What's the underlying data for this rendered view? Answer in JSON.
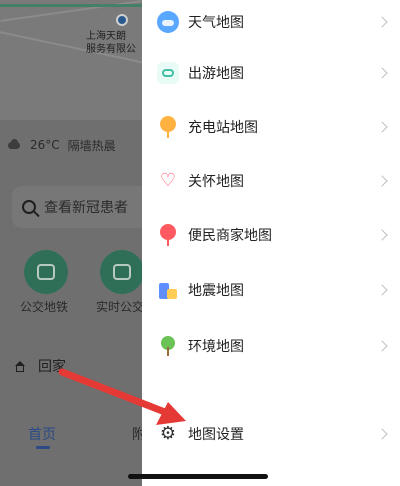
{
  "background": {
    "map_label": "上海天朗\n服务有限公",
    "weather": {
      "temperature": "26°C",
      "text": "隔墙热晨"
    },
    "search": {
      "placeholder": "查看新冠患者"
    },
    "quick_actions": [
      {
        "label": "公交地铁",
        "icon": "bus-icon"
      },
      {
        "label": "实时公交",
        "icon": "realtime-bus-icon"
      }
    ],
    "home_label": "回家",
    "tabs": [
      {
        "label": "首页"
      },
      {
        "label": "附"
      }
    ]
  },
  "menu": {
    "items": [
      {
        "label": "天气地图",
        "icon": "weather-icon"
      },
      {
        "label": "出游地图",
        "icon": "travel-icon"
      },
      {
        "label": "充电站地图",
        "icon": "charging-station-icon"
      },
      {
        "label": "关怀地图",
        "icon": "care-heart-icon"
      },
      {
        "label": "便民商家地图",
        "icon": "merchant-icon"
      },
      {
        "label": "地震地图",
        "icon": "earthquake-icon"
      },
      {
        "label": "环境地图",
        "icon": "environment-tree-icon"
      },
      {
        "label": "地图设置",
        "icon": "gear-icon"
      }
    ]
  },
  "annotation": {
    "arrow_color": "#e53935",
    "arrow_icon": "arrow-pointer-icon"
  }
}
